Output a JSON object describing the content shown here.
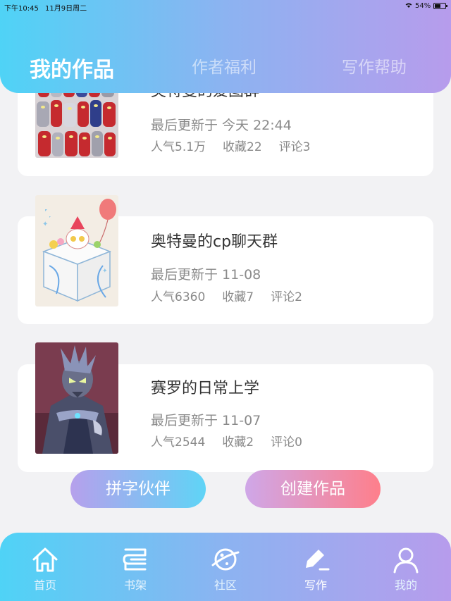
{
  "status_bar": {
    "time": "下午10:45",
    "date": "11月9日周二",
    "battery_text": "54%",
    "battery_level": 0.54
  },
  "tabs": [
    {
      "label": "我的作品",
      "active": true
    },
    {
      "label": "作者福利",
      "active": false
    },
    {
      "label": "写作帮助",
      "active": false
    }
  ],
  "works": [
    {
      "title": "奥特曼的爱图群",
      "updated": "最后更新于 今天 22:44",
      "popularity": "人气5.1万",
      "favorites": "收藏22",
      "comments": "评论3",
      "cover_icon": "ultraman-group-cover"
    },
    {
      "title": "奥特曼的cp聊天群",
      "updated": "最后更新于 11-08",
      "popularity": "人气6360",
      "favorites": "收藏7",
      "comments": "评论2",
      "cover_icon": "gift-box-cover"
    },
    {
      "title": "赛罗的日常上学",
      "updated": "最后更新于 11-07",
      "popularity": "人气2544",
      "favorites": "收藏2",
      "comments": "评论0",
      "cover_icon": "zero-hero-cover"
    }
  ],
  "actions": {
    "partner_label": "拼字伙伴",
    "create_label": "创建作品"
  },
  "tabbar": [
    {
      "label": "首页",
      "icon": "home-icon",
      "active": false
    },
    {
      "label": "书架",
      "icon": "bookshelf-icon",
      "active": false
    },
    {
      "label": "社区",
      "icon": "planet-icon",
      "active": false
    },
    {
      "label": "写作",
      "icon": "pen-icon",
      "active": true
    },
    {
      "label": "我的",
      "icon": "user-icon",
      "active": false
    }
  ],
  "colors": {
    "gradient_start": "#4fd3f6",
    "gradient_end": "#b79cec",
    "create_button": "#fe7f8b",
    "background": "#f2f2f4"
  }
}
